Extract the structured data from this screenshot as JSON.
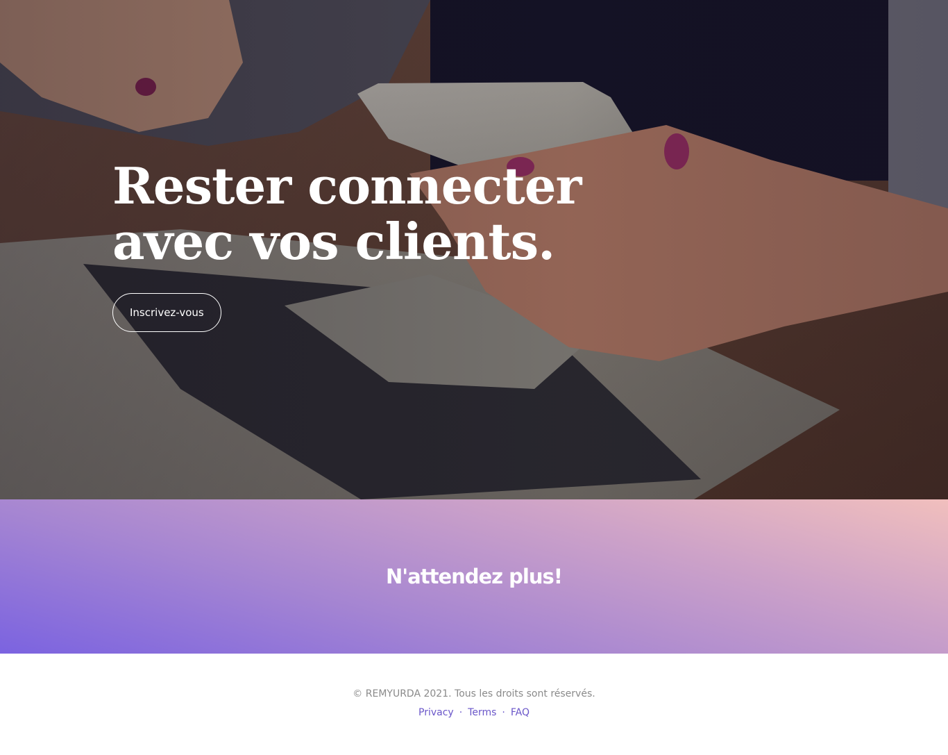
{
  "hero": {
    "title": "Rester connecter\navec vos clients.",
    "cta_label": "Inscrivez-vous"
  },
  "band": {
    "title": "N'attendez plus!"
  },
  "footer": {
    "copyright": "© REMYURDA 2021. Tous les droits sont réservés.",
    "links": [
      {
        "label": "Privacy"
      },
      {
        "label": "Terms"
      },
      {
        "label": "FAQ"
      }
    ],
    "separator": "·"
  },
  "colors": {
    "accent": "#6a56c9",
    "gradient_start": "#7b63e0",
    "gradient_end": "#f1bfbd"
  }
}
